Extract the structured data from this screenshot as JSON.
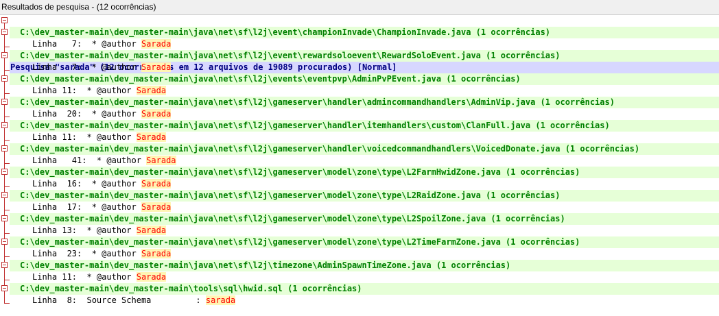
{
  "window": {
    "title": "Resultados de pesquisa - (12 ocorrências)"
  },
  "search_header": "Pesquisa \"sarada\" (12 ocorrências em 12 arquivos de 19089 procurados) [Normal]",
  "colors": {
    "header_bg": "#d7d7ff",
    "header_text": "#000080",
    "file_bg": "#e6ffd7",
    "file_text": "#008000",
    "match_bg": "#fff5b4",
    "match_text": "#ff0000",
    "tree_lines": "#c03030"
  },
  "icons": {
    "fold": "collapse-minus-icon"
  },
  "results": [
    {
      "file": "C:\\dev_master-main\\dev_master-main\\java\\net\\sf\\l2j\\event\\championInvade\\ChampionInvade.java (1 ocorrências)",
      "line_prefix": "Linha   7:  * @author ",
      "match": "Sarada"
    },
    {
      "file": "C:\\dev_master-main\\dev_master-main\\java\\net\\sf\\l2j\\event\\rewardsoloevent\\RewardSoloEvent.java (1 ocorrências)",
      "line_prefix": "Linha   7:  * @author ",
      "match": "Sarada"
    },
    {
      "file": "C:\\dev_master-main\\dev_master-main\\java\\net\\sf\\l2j\\events\\eventpvp\\AdminPvPEvent.java (1 ocorrências)",
      "line_prefix": "Linha 11:  * @author ",
      "match": "Sarada"
    },
    {
      "file": "C:\\dev_master-main\\dev_master-main\\java\\net\\sf\\l2j\\gameserver\\handler\\admincommandhandlers\\AdminVip.java (1 ocorrências)",
      "line_prefix": "Linha  20:  * @author ",
      "match": "Sarada"
    },
    {
      "file": "C:\\dev_master-main\\dev_master-main\\java\\net\\sf\\l2j\\gameserver\\handler\\itemhandlers\\custom\\ClanFull.java (1 ocorrências)",
      "line_prefix": "Linha 11:  * @author ",
      "match": "Sarada"
    },
    {
      "file": "C:\\dev_master-main\\dev_master-main\\java\\net\\sf\\l2j\\gameserver\\handler\\voicedcommandhandlers\\VoicedDonate.java (1 ocorrências)",
      "line_prefix": "Linha   41:  * @author ",
      "match": "Sarada"
    },
    {
      "file": "C:\\dev_master-main\\dev_master-main\\java\\net\\sf\\l2j\\gameserver\\model\\zone\\type\\L2FarmHwidZone.java (1 ocorrências)",
      "line_prefix": "Linha  16:  * @author ",
      "match": "Sarada"
    },
    {
      "file": "C:\\dev_master-main\\dev_master-main\\java\\net\\sf\\l2j\\gameserver\\model\\zone\\type\\L2RaidZone.java (1 ocorrências)",
      "line_prefix": "Linha  17:  * @author ",
      "match": "Sarada"
    },
    {
      "file": "C:\\dev_master-main\\dev_master-main\\java\\net\\sf\\l2j\\gameserver\\model\\zone\\type\\L2SpoilZone.java (1 ocorrências)",
      "line_prefix": "Linha 13:  * @author ",
      "match": "Sarada"
    },
    {
      "file": "C:\\dev_master-main\\dev_master-main\\java\\net\\sf\\l2j\\gameserver\\model\\zone\\type\\L2TimeFarmZone.java (1 ocorrências)",
      "line_prefix": "Linha  23:  * @author ",
      "match": "Sarada"
    },
    {
      "file": "C:\\dev_master-main\\dev_master-main\\java\\net\\sf\\l2j\\timezone\\AdminSpawnTimeZone.java (1 ocorrências)",
      "line_prefix": "Linha 11:  * @author ",
      "match": "Sarada"
    },
    {
      "file": "C:\\dev_master-main\\dev_master-main\\tools\\sql\\hwid.sql (1 ocorrências)",
      "line_prefix": "Linha  8:  Source Schema         : ",
      "match": "sarada"
    }
  ]
}
